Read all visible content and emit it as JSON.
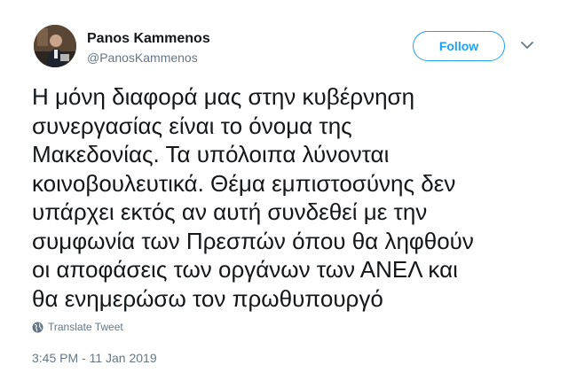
{
  "author": {
    "name": "Panos Kammenos",
    "handle": "@PanosKammenos"
  },
  "actions": {
    "follow_label": "Follow"
  },
  "tweet": {
    "text": "Η μόνη  διαφορά μας στην κυβέρνηση\nσυνεργασίας είναι το όνομα της\nΜακεδονίας. Τα υπόλοιπα λύνονται\nκοινοβουλευτικά. Θέμα εμπιστοσύνης δεν\nυπάρχει εκτός αν αυτή συνδεθεί με την\nσυμφωνία των Πρεσπών όπου θα ληφθούν\nοι αποφάσεις των οργάνων των ΑΝΕΛ και\nθα ενημερώσω τον πρωθυπουργό",
    "translate_label": "Translate Tweet",
    "timestamp": "3:45 PM - 11 Jan 2019"
  },
  "icons": {
    "globe": "globe-icon",
    "caret": "chevron-down-icon"
  },
  "colors": {
    "accent": "#1da1f2",
    "text": "#14171a",
    "muted": "#657786"
  }
}
